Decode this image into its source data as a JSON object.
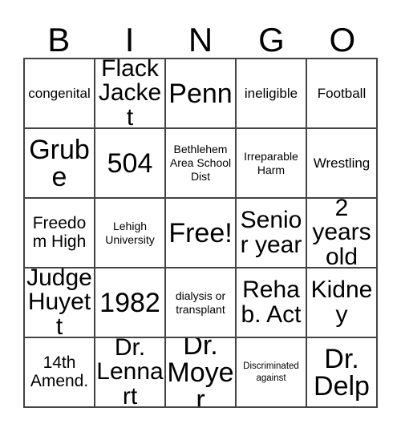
{
  "card": {
    "title": "BINGO",
    "header": {
      "letters": [
        "B",
        "I",
        "N",
        "G",
        "O"
      ]
    },
    "grid": {
      "columns": 5,
      "rows": 5,
      "cells": [
        [
          {
            "text": "congenital",
            "size": "sm",
            "free": false
          },
          {
            "text": "Flack Jacket",
            "size": "xl",
            "free": false
          },
          {
            "text": "Penn",
            "size": "xxl",
            "free": false
          },
          {
            "text": "ineligible",
            "size": "sm",
            "free": false
          },
          {
            "text": "Football",
            "size": "sm",
            "free": false
          }
        ],
        [
          {
            "text": "Grube",
            "size": "xxl",
            "free": false
          },
          {
            "text": "504",
            "size": "xxl",
            "free": false
          },
          {
            "text": "Bethlehem Area School Dist",
            "size": "xs",
            "free": false
          },
          {
            "text": "Irreparable Harm",
            "size": "xs",
            "free": false
          },
          {
            "text": "Wrestling",
            "size": "sm",
            "free": false
          }
        ],
        [
          {
            "text": "Freedom High",
            "size": "md",
            "free": false
          },
          {
            "text": "Lehigh University",
            "size": "xs",
            "free": false
          },
          {
            "text": "Free!",
            "size": "xxl",
            "free": true
          },
          {
            "text": "Senior year",
            "size": "xl",
            "free": false
          },
          {
            "text": "2 years old",
            "size": "xl",
            "free": false
          }
        ],
        [
          {
            "text": "Judge Huyett",
            "size": "xl",
            "free": false
          },
          {
            "text": "1982",
            "size": "xxl",
            "free": false
          },
          {
            "text": "dialysis or transplant",
            "size": "xs",
            "free": false
          },
          {
            "text": "Rehab. Act",
            "size": "xl",
            "free": false
          },
          {
            "text": "Kidney",
            "size": "xl",
            "free": false
          }
        ],
        [
          {
            "text": "14th Amend.",
            "size": "md",
            "free": false
          },
          {
            "text": "Dr. Lennart",
            "size": "xl",
            "free": false
          },
          {
            "text": "Dr. Moyer",
            "size": "xxl",
            "free": false
          },
          {
            "text": "Discriminated against",
            "size": "xxs",
            "free": false
          },
          {
            "text": "Dr. Delp",
            "size": "xxl",
            "free": false
          }
        ]
      ]
    },
    "colors": {
      "background": "#ffffff",
      "text": "#000000",
      "grid_line": "#444444"
    }
  }
}
